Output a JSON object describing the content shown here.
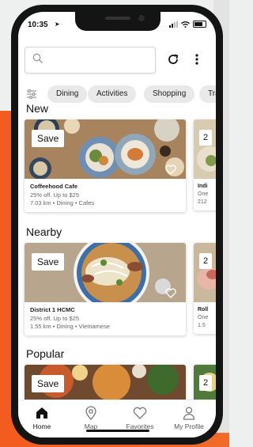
{
  "status_bar": {
    "time": "10:35"
  },
  "search": {
    "placeholder": ""
  },
  "chips": [
    "Dining",
    "Activities",
    "Shopping",
    "Trave"
  ],
  "sections": {
    "new": {
      "title": "New",
      "card": {
        "save_label": "Save",
        "name": "Coffeehood Cafe",
        "offer": "25% off. Up to $25",
        "meta": "7.03 km • Dining • Cafes"
      },
      "peek": {
        "badge": "2",
        "line1": "Indi",
        "line2": "One",
        "line3": "212"
      }
    },
    "nearby": {
      "title": "Nearby",
      "card": {
        "save_label": "Save",
        "name": "District 1 HCMC",
        "offer": "25% off. Up to $25",
        "meta": "1.55 km • Dining • Vietnamese"
      },
      "peek": {
        "badge": "2",
        "line1": "Roll",
        "line2": "One",
        "line3": "1.5"
      }
    },
    "popular": {
      "title": "Popular",
      "card": {
        "save_label": "Save"
      },
      "peek": {
        "badge": "2"
      }
    }
  },
  "nav": [
    {
      "label": "Home",
      "icon": "home-icon",
      "active": true
    },
    {
      "label": "Map",
      "icon": "map-pin-icon",
      "active": false
    },
    {
      "label": "Favorites",
      "icon": "heart-icon",
      "active": false
    },
    {
      "label": "My Profile",
      "icon": "person-icon",
      "active": false
    }
  ]
}
